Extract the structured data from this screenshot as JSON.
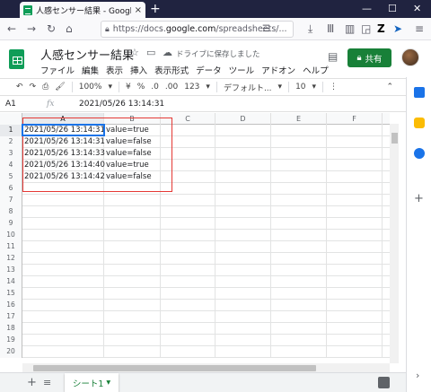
{
  "browser": {
    "tab_title": "人感センサー結果 - Google スプレ",
    "tab_close": "×",
    "new_tab": "+",
    "minimize": "—",
    "maximize": "☐",
    "close": "✕",
    "url_prefix": "https://docs.",
    "url_host": "google.com",
    "url_suffix": "/spreadsheets/..."
  },
  "sheets": {
    "title": "人感センサー結果",
    "save_status": "ドライブに保存しました",
    "share_label": "共有",
    "menu": [
      "ファイル",
      "編集",
      "表示",
      "挿入",
      "表示形式",
      "データ",
      "ツール",
      "アドオン",
      "ヘルプ"
    ],
    "toolbar": {
      "zoom": "100%",
      "currency": "¥",
      "percent": "%",
      "decimal_less": ".0",
      "decimal_more": ".00",
      "number_format": "123",
      "font": "デフォルト...",
      "font_size": "10"
    },
    "formula": {
      "cell_ref": "A1",
      "fx": "fx",
      "value": "2021/05/26 13:14:31"
    },
    "columns": [
      "A",
      "B",
      "C",
      "D",
      "E",
      "F"
    ],
    "rows": [
      {
        "num": "1",
        "a": "2021/05/26 13:14:31",
        "b": "value=true"
      },
      {
        "num": "2",
        "a": "2021/05/26 13:14:31",
        "b": "value=false"
      },
      {
        "num": "3",
        "a": "2021/05/26 13:14:33",
        "b": "value=false"
      },
      {
        "num": "4",
        "a": "2021/05/26 13:14:40",
        "b": "value=true"
      },
      {
        "num": "5",
        "a": "2021/05/26 13:14:42",
        "b": "value=false"
      },
      {
        "num": "6",
        "a": "",
        "b": ""
      },
      {
        "num": "7",
        "a": "",
        "b": ""
      },
      {
        "num": "8",
        "a": "",
        "b": ""
      },
      {
        "num": "9",
        "a": "",
        "b": ""
      },
      {
        "num": "10",
        "a": "",
        "b": ""
      },
      {
        "num": "11",
        "a": "",
        "b": ""
      },
      {
        "num": "12",
        "a": "",
        "b": ""
      },
      {
        "num": "13",
        "a": "",
        "b": ""
      },
      {
        "num": "14",
        "a": "",
        "b": ""
      },
      {
        "num": "15",
        "a": "",
        "b": ""
      },
      {
        "num": "16",
        "a": "",
        "b": ""
      },
      {
        "num": "17",
        "a": "",
        "b": ""
      },
      {
        "num": "18",
        "a": "",
        "b": ""
      },
      {
        "num": "19",
        "a": "",
        "b": ""
      },
      {
        "num": "20",
        "a": "",
        "b": ""
      }
    ],
    "sheet_tab": "シート1",
    "accent": "#188038",
    "selection_color": "#1a73e8",
    "highlight_color": "#e53935"
  }
}
